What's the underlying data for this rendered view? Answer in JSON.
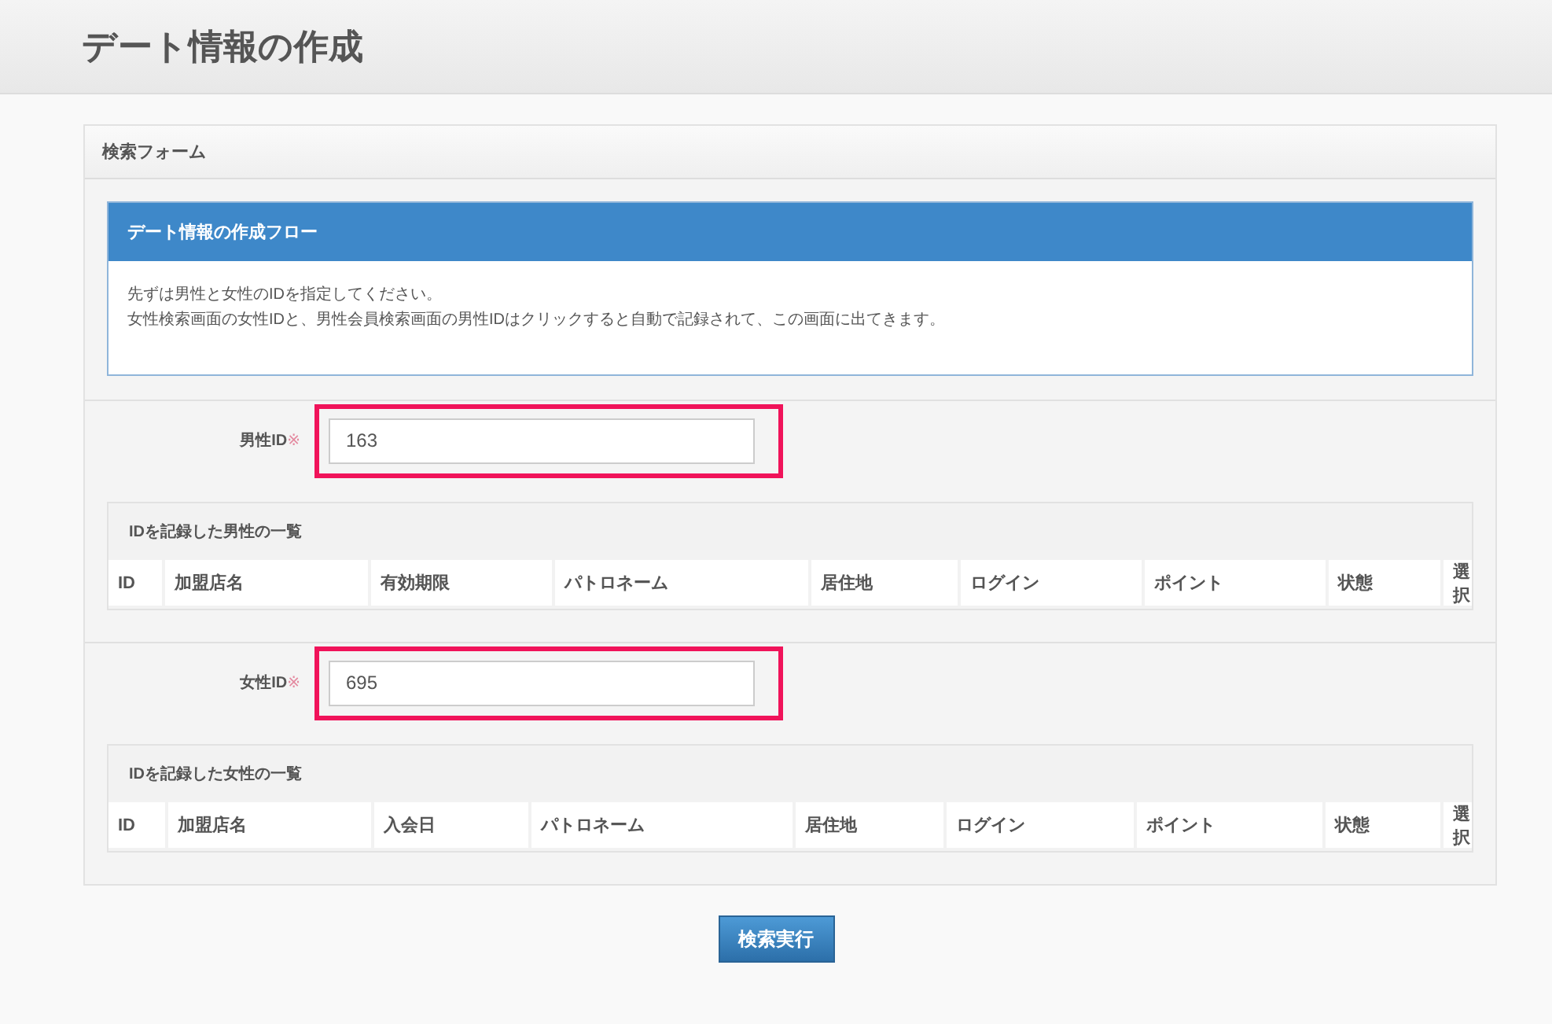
{
  "page_title": "デート情報の作成",
  "panel": {
    "title": "検索フォーム",
    "info_box": {
      "title": "デート情報の作成フロー",
      "lines": [
        "先ずは男性と女性のIDを指定してください。",
        "女性検索画面の女性IDと、男性会員検索画面の男性IDはクリックすると自動で記録されて、この画面に出てきます。"
      ]
    },
    "sections": [
      {
        "field": {
          "label": "男性ID",
          "required_mark": "※",
          "value": "163"
        },
        "table": {
          "caption": "IDを記録した男性の一覧",
          "columns": [
            "ID",
            "加盟店名",
            "有効期限",
            "パトロネーム",
            "居住地",
            "ログイン",
            "ポイント",
            "状態",
            "選択"
          ]
        }
      },
      {
        "field": {
          "label": "女性ID",
          "required_mark": "※",
          "value": "695"
        },
        "table": {
          "caption": "IDを記録した女性の一覧",
          "columns": [
            "ID",
            "加盟店名",
            "入会日",
            "パトロネーム",
            "居住地",
            "ログイン",
            "ポイント",
            "状態",
            "選択"
          ]
        }
      }
    ]
  },
  "submit_button": "検索実行"
}
